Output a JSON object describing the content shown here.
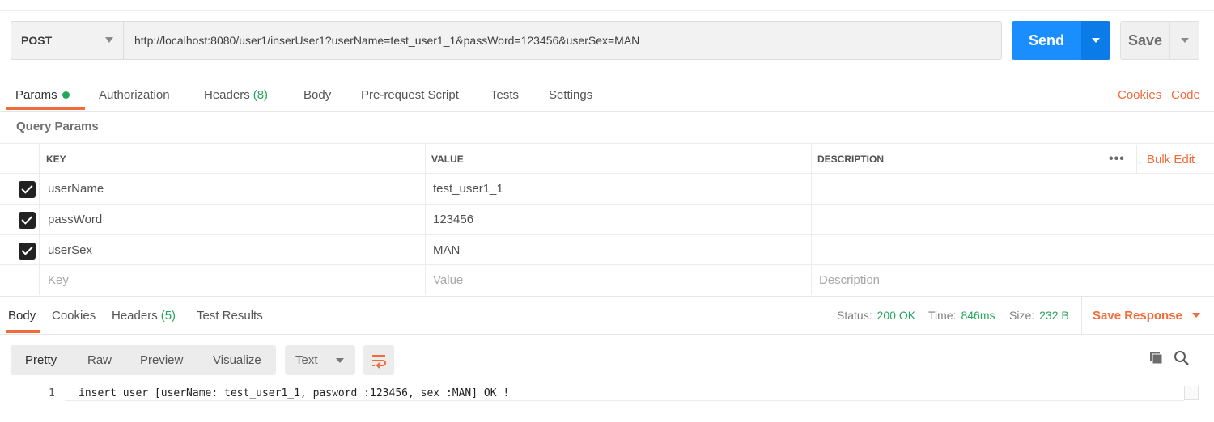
{
  "request": {
    "method": "POST",
    "url": "http://localhost:8080/user1/inserUser1?userName=test_user1_1&passWord=123456&userSex=MAN",
    "send_label": "Send",
    "save_label": "Save"
  },
  "tabs": {
    "params": "Params",
    "authorization": "Authorization",
    "headers": "Headers",
    "headers_count": "(8)",
    "body": "Body",
    "prerequest": "Pre-request Script",
    "tests": "Tests",
    "settings": "Settings",
    "cookies": "Cookies",
    "code": "Code"
  },
  "params": {
    "title": "Query Params",
    "columns": {
      "key": "KEY",
      "value": "VALUE",
      "description": "DESCRIPTION"
    },
    "more": "•••",
    "bulk_edit": "Bulk Edit",
    "rows": [
      {
        "key": "userName",
        "value": "test_user1_1",
        "checked": true
      },
      {
        "key": "passWord",
        "value": "123456",
        "checked": true
      },
      {
        "key": "userSex",
        "value": "MAN",
        "checked": true
      }
    ],
    "placeholder": {
      "key": "Key",
      "value": "Value",
      "description": "Description"
    }
  },
  "response": {
    "tabs": {
      "body": "Body",
      "cookies": "Cookies",
      "headers": "Headers",
      "headers_count": "(5)",
      "test_results": "Test Results"
    },
    "status_label": "Status:",
    "status_value": "200 OK",
    "time_label": "Time:",
    "time_value": "846ms",
    "size_label": "Size:",
    "size_value": "232 B",
    "save_response": "Save Response",
    "view": {
      "pretty": "Pretty",
      "raw": "Raw",
      "preview": "Preview",
      "visualize": "Visualize"
    },
    "format": "Text",
    "lines": [
      {
        "number": "1",
        "text": "insert user [userName: test_user1_1, pasword :123456, sex :MAN] OK !"
      }
    ]
  },
  "colors": {
    "accent": "#f26b3a",
    "send": "#1a8dff",
    "success": "#26a65b"
  }
}
